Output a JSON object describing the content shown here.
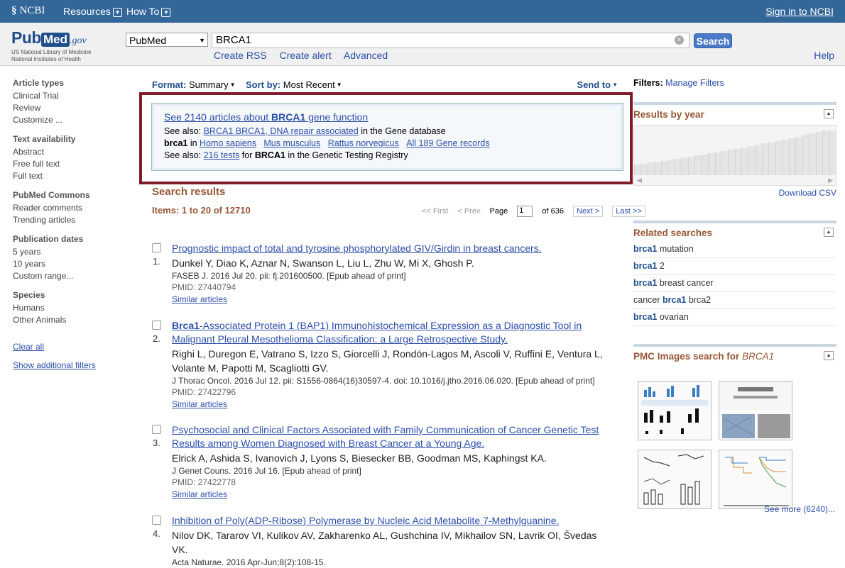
{
  "topbar": {
    "ncbi": "NCBI",
    "resources": "Resources",
    "howto": "How To",
    "signin": "Sign in to NCBI"
  },
  "logo": {
    "pub": "Pub",
    "med": "Med",
    "gov": ".gov",
    "line1": "US National Library of Medicine",
    "line2": "National Institutes of Health"
  },
  "search": {
    "db": "PubMed",
    "query": "BRCA1",
    "button": "Search",
    "create_rss": "Create RSS",
    "create_alert": "Create alert",
    "advanced": "Advanced",
    "help": "Help"
  },
  "leftnav": {
    "article_types": "Article types",
    "clinical_trial": "Clinical Trial",
    "review": "Review",
    "customize": "Customize ...",
    "text_availability": "Text availability",
    "abstract": "Abstract",
    "free_full_text": "Free full text",
    "full_text": "Full text",
    "pubmed_commons": "PubMed Commons",
    "reader_comments": "Reader comments",
    "trending": "Trending articles",
    "pub_dates": "Publication dates",
    "y5": "5 years",
    "y10": "10 years",
    "custom_range": "Custom range...",
    "species": "Species",
    "humans": "Humans",
    "other_animals": "Other Animals",
    "clear_all": "Clear all",
    "show_filters": "Show additional filters"
  },
  "formatbar": {
    "format_label": "Format:",
    "format_value": "Summary",
    "sort_label": "Sort by:",
    "sort_value": "Most Recent",
    "send_to": "Send to"
  },
  "suggest": {
    "see_prefix": "See 2140 articles about ",
    "see_bold": "BRCA1",
    "see_suffix": " gene function",
    "also1_prefix": "See also: ",
    "also1_link": "BRCA1 BRCA1, DNA repair associated",
    "also1_suffix": " in the Gene database",
    "brca1": "brca1",
    "in": " in ",
    "org1": "Homo sapiens",
    "org2": "Mus musculus",
    "org3": "Rattus norvegicus",
    "org4": "All 189 Gene records",
    "also2_prefix": "See also: ",
    "also2_link": "216 tests",
    "also2_mid": " for ",
    "also2_bold": "BRCA1",
    "also2_suffix": " in the Genetic Testing Registry"
  },
  "results": {
    "title": "Search results",
    "items": "Items: 1 to 20 of 12710",
    "first": "<< First",
    "prev": "< Prev",
    "page_label": "Page",
    "page_value": "1",
    "of": "of 636",
    "next": "Next >",
    "last": "Last >>",
    "list": [
      {
        "num": "1.",
        "title": "Prognostic impact of total and tyrosine phosphorylated GIV/Girdin in breast cancers.",
        "authors": "Dunkel Y, Diao K, Aznar N, Swanson L, Liu L, Zhu W, Mi X, Ghosh P.",
        "journal": "FASEB J. 2016 Jul 20. pii: fj.201600500. [Epub ahead of print]",
        "pmid": "PMID: 27440794",
        "similar": "Similar articles"
      },
      {
        "num": "2.",
        "title_bold": "Brca1",
        "title_rest": "-Associated Protein 1 (BAP1) Immunohistochemical Expression as a Diagnostic Tool in Malignant Pleural Mesothelioma Classification: a Large Retrospective Study.",
        "authors": "Righi L, Duregon E, Vatrano S, Izzo S, Giorcelli J, Rondón-Lagos M, Ascoli V, Ruffini E, Ventura L, Volante M, Papotti M, Scagliotti GV.",
        "journal": "J Thorac Oncol. 2016 Jul 12. pii: S1556-0864(16)30597-4. doi: 10.1016/j.jtho.2016.06.020. [Epub ahead of print]",
        "pmid": "PMID: 27422796",
        "similar": "Similar articles"
      },
      {
        "num": "3.",
        "title": "Psychosocial and Clinical Factors Associated with Family Communication of Cancer Genetic Test Results among Women Diagnosed with Breast Cancer at a Young Age.",
        "authors": "Elrick A, Ashida S, Ivanovich J, Lyons S, Biesecker BB, Goodman MS, Kaphingst KA.",
        "journal": "J Genet Couns. 2016 Jul 16. [Epub ahead of print]",
        "pmid": "PMID: 27422778",
        "similar": "Similar articles"
      },
      {
        "num": "4.",
        "title": "Inhibition of Poly(ADP-Ribose) Polymerase by Nucleic Acid Metabolite 7-Methylguanine.",
        "authors": "Nilov DK, Tararov VI, Kulikov AV, Zakharenko AL, Gushchina IV, Mikhailov SN, Lavrik OI, Švedas VK.",
        "journal": "Acta Naturae. 2016 Apr-Jun;8(2):108-15."
      }
    ]
  },
  "right": {
    "filters_label": "Filters:",
    "manage": "Manage Filters",
    "results_by_year": "Results by year",
    "download_csv": "Download CSV",
    "year_counts": [
      0.22,
      0.25,
      0.27,
      0.28,
      0.3,
      0.33,
      0.35,
      0.38,
      0.4,
      0.42,
      0.44,
      0.47,
      0.49,
      0.52,
      0.54,
      0.56,
      0.59,
      0.62,
      0.65,
      0.68,
      0.7,
      0.73,
      0.76,
      0.79,
      0.82,
      0.86,
      0.89,
      0.92,
      0.96,
      0.94
    ],
    "related_title": "Related searches",
    "related": [
      {
        "b": "brca1",
        "t": " mutation"
      },
      {
        "b": "brca1",
        "t": " 2"
      },
      {
        "b": "brca1",
        "t": " breast cancer"
      },
      {
        "pre": "cancer ",
        "b": "brca1",
        "t": " brca2"
      },
      {
        "b": "brca1",
        "t": " ovarian"
      }
    ],
    "pmc_title": "PMC Images search for ",
    "pmc_term": "BRCA1",
    "see_more": "See more (6240)..."
  }
}
